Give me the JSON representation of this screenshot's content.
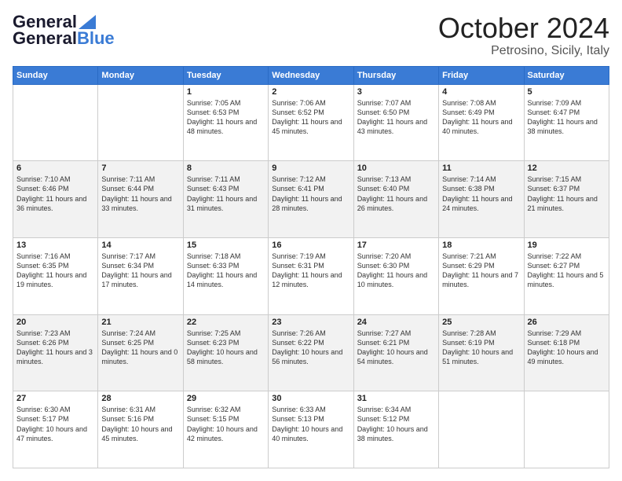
{
  "header": {
    "logo_line1": "General",
    "logo_line2": "Blue",
    "month": "October 2024",
    "location": "Petrosino, Sicily, Italy"
  },
  "days_of_week": [
    "Sunday",
    "Monday",
    "Tuesday",
    "Wednesday",
    "Thursday",
    "Friday",
    "Saturday"
  ],
  "weeks": [
    [
      {
        "day": "",
        "sunrise": "",
        "sunset": "",
        "daylight": ""
      },
      {
        "day": "",
        "sunrise": "",
        "sunset": "",
        "daylight": ""
      },
      {
        "day": "1",
        "sunrise": "Sunrise: 7:05 AM",
        "sunset": "Sunset: 6:53 PM",
        "daylight": "Daylight: 11 hours and 48 minutes."
      },
      {
        "day": "2",
        "sunrise": "Sunrise: 7:06 AM",
        "sunset": "Sunset: 6:52 PM",
        "daylight": "Daylight: 11 hours and 45 minutes."
      },
      {
        "day": "3",
        "sunrise": "Sunrise: 7:07 AM",
        "sunset": "Sunset: 6:50 PM",
        "daylight": "Daylight: 11 hours and 43 minutes."
      },
      {
        "day": "4",
        "sunrise": "Sunrise: 7:08 AM",
        "sunset": "Sunset: 6:49 PM",
        "daylight": "Daylight: 11 hours and 40 minutes."
      },
      {
        "day": "5",
        "sunrise": "Sunrise: 7:09 AM",
        "sunset": "Sunset: 6:47 PM",
        "daylight": "Daylight: 11 hours and 38 minutes."
      }
    ],
    [
      {
        "day": "6",
        "sunrise": "Sunrise: 7:10 AM",
        "sunset": "Sunset: 6:46 PM",
        "daylight": "Daylight: 11 hours and 36 minutes."
      },
      {
        "day": "7",
        "sunrise": "Sunrise: 7:11 AM",
        "sunset": "Sunset: 6:44 PM",
        "daylight": "Daylight: 11 hours and 33 minutes."
      },
      {
        "day": "8",
        "sunrise": "Sunrise: 7:11 AM",
        "sunset": "Sunset: 6:43 PM",
        "daylight": "Daylight: 11 hours and 31 minutes."
      },
      {
        "day": "9",
        "sunrise": "Sunrise: 7:12 AM",
        "sunset": "Sunset: 6:41 PM",
        "daylight": "Daylight: 11 hours and 28 minutes."
      },
      {
        "day": "10",
        "sunrise": "Sunrise: 7:13 AM",
        "sunset": "Sunset: 6:40 PM",
        "daylight": "Daylight: 11 hours and 26 minutes."
      },
      {
        "day": "11",
        "sunrise": "Sunrise: 7:14 AM",
        "sunset": "Sunset: 6:38 PM",
        "daylight": "Daylight: 11 hours and 24 minutes."
      },
      {
        "day": "12",
        "sunrise": "Sunrise: 7:15 AM",
        "sunset": "Sunset: 6:37 PM",
        "daylight": "Daylight: 11 hours and 21 minutes."
      }
    ],
    [
      {
        "day": "13",
        "sunrise": "Sunrise: 7:16 AM",
        "sunset": "Sunset: 6:35 PM",
        "daylight": "Daylight: 11 hours and 19 minutes."
      },
      {
        "day": "14",
        "sunrise": "Sunrise: 7:17 AM",
        "sunset": "Sunset: 6:34 PM",
        "daylight": "Daylight: 11 hours and 17 minutes."
      },
      {
        "day": "15",
        "sunrise": "Sunrise: 7:18 AM",
        "sunset": "Sunset: 6:33 PM",
        "daylight": "Daylight: 11 hours and 14 minutes."
      },
      {
        "day": "16",
        "sunrise": "Sunrise: 7:19 AM",
        "sunset": "Sunset: 6:31 PM",
        "daylight": "Daylight: 11 hours and 12 minutes."
      },
      {
        "day": "17",
        "sunrise": "Sunrise: 7:20 AM",
        "sunset": "Sunset: 6:30 PM",
        "daylight": "Daylight: 11 hours and 10 minutes."
      },
      {
        "day": "18",
        "sunrise": "Sunrise: 7:21 AM",
        "sunset": "Sunset: 6:29 PM",
        "daylight": "Daylight: 11 hours and 7 minutes."
      },
      {
        "day": "19",
        "sunrise": "Sunrise: 7:22 AM",
        "sunset": "Sunset: 6:27 PM",
        "daylight": "Daylight: 11 hours and 5 minutes."
      }
    ],
    [
      {
        "day": "20",
        "sunrise": "Sunrise: 7:23 AM",
        "sunset": "Sunset: 6:26 PM",
        "daylight": "Daylight: 11 hours and 3 minutes."
      },
      {
        "day": "21",
        "sunrise": "Sunrise: 7:24 AM",
        "sunset": "Sunset: 6:25 PM",
        "daylight": "Daylight: 11 hours and 0 minutes."
      },
      {
        "day": "22",
        "sunrise": "Sunrise: 7:25 AM",
        "sunset": "Sunset: 6:23 PM",
        "daylight": "Daylight: 10 hours and 58 minutes."
      },
      {
        "day": "23",
        "sunrise": "Sunrise: 7:26 AM",
        "sunset": "Sunset: 6:22 PM",
        "daylight": "Daylight: 10 hours and 56 minutes."
      },
      {
        "day": "24",
        "sunrise": "Sunrise: 7:27 AM",
        "sunset": "Sunset: 6:21 PM",
        "daylight": "Daylight: 10 hours and 54 minutes."
      },
      {
        "day": "25",
        "sunrise": "Sunrise: 7:28 AM",
        "sunset": "Sunset: 6:19 PM",
        "daylight": "Daylight: 10 hours and 51 minutes."
      },
      {
        "day": "26",
        "sunrise": "Sunrise: 7:29 AM",
        "sunset": "Sunset: 6:18 PM",
        "daylight": "Daylight: 10 hours and 49 minutes."
      }
    ],
    [
      {
        "day": "27",
        "sunrise": "Sunrise: 6:30 AM",
        "sunset": "Sunset: 5:17 PM",
        "daylight": "Daylight: 10 hours and 47 minutes."
      },
      {
        "day": "28",
        "sunrise": "Sunrise: 6:31 AM",
        "sunset": "Sunset: 5:16 PM",
        "daylight": "Daylight: 10 hours and 45 minutes."
      },
      {
        "day": "29",
        "sunrise": "Sunrise: 6:32 AM",
        "sunset": "Sunset: 5:15 PM",
        "daylight": "Daylight: 10 hours and 42 minutes."
      },
      {
        "day": "30",
        "sunrise": "Sunrise: 6:33 AM",
        "sunset": "Sunset: 5:13 PM",
        "daylight": "Daylight: 10 hours and 40 minutes."
      },
      {
        "day": "31",
        "sunrise": "Sunrise: 6:34 AM",
        "sunset": "Sunset: 5:12 PM",
        "daylight": "Daylight: 10 hours and 38 minutes."
      },
      {
        "day": "",
        "sunrise": "",
        "sunset": "",
        "daylight": ""
      },
      {
        "day": "",
        "sunrise": "",
        "sunset": "",
        "daylight": ""
      }
    ]
  ]
}
